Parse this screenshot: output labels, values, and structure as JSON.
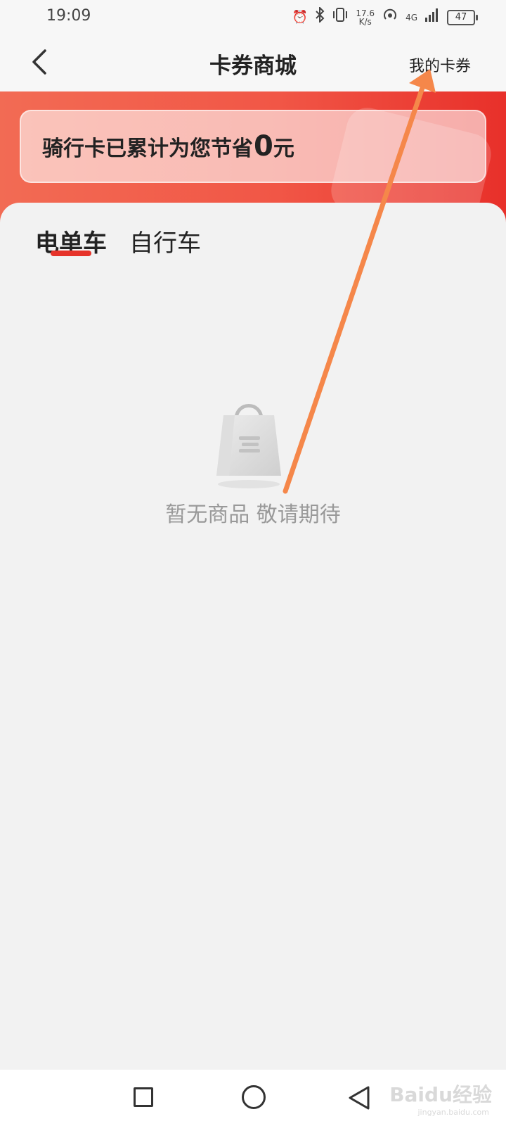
{
  "status_bar": {
    "time": "19:09",
    "alarm_icon": "alarm-icon",
    "bluetooth_icon": "bluetooth-icon",
    "vibrate_icon": "vibrate-icon",
    "speed_value": "17.6",
    "speed_unit": "K/s",
    "hotspot_icon": "hotspot-icon",
    "network": "4G",
    "signal_icon": "signal-icon",
    "battery": "47"
  },
  "nav": {
    "back_icon": "chevron-left-icon",
    "title": "卡券商城",
    "my_coupons": "我的卡券"
  },
  "hero": {
    "saving_text": "骑行卡已累计为您节省",
    "saving_amount": "0",
    "saving_unit": "元"
  },
  "tabs": [
    {
      "label": "电单车",
      "active": true
    },
    {
      "label": "自行车",
      "active": false
    }
  ],
  "empty_state": {
    "icon": "shopping-bag-icon",
    "text": "暂无商品 敬请期待"
  },
  "colors": {
    "accent": "#e6332a",
    "hero_start": "#f26b54",
    "hero_end": "#e8302a",
    "annotation_arrow": "#f5874a"
  },
  "watermark": {
    "text": "Baidu经验",
    "sub": "jingyan.baidu.com"
  }
}
